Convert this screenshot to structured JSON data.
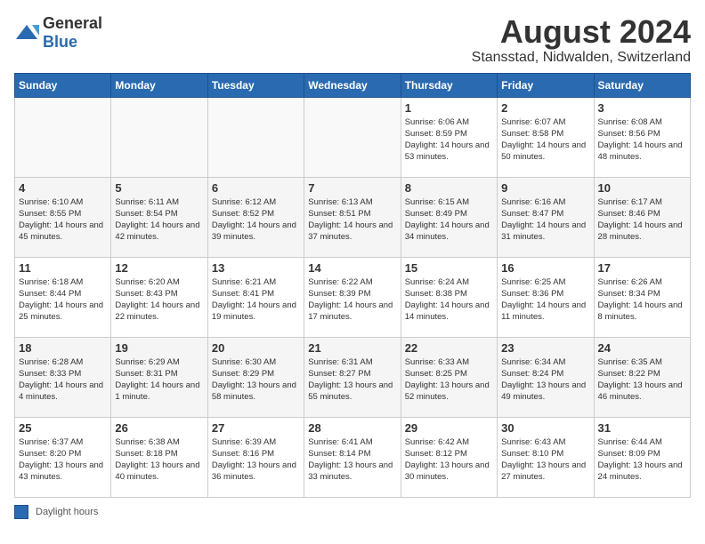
{
  "logo": {
    "general": "General",
    "blue": "Blue"
  },
  "title": "August 2024",
  "subtitle": "Stansstad, Nidwalden, Switzerland",
  "weekdays": [
    "Sunday",
    "Monday",
    "Tuesday",
    "Wednesday",
    "Thursday",
    "Friday",
    "Saturday"
  ],
  "weeks": [
    [
      {
        "day": "",
        "info": ""
      },
      {
        "day": "",
        "info": ""
      },
      {
        "day": "",
        "info": ""
      },
      {
        "day": "",
        "info": ""
      },
      {
        "day": "1",
        "info": "Sunrise: 6:06 AM\nSunset: 8:59 PM\nDaylight: 14 hours and 53 minutes."
      },
      {
        "day": "2",
        "info": "Sunrise: 6:07 AM\nSunset: 8:58 PM\nDaylight: 14 hours and 50 minutes."
      },
      {
        "day": "3",
        "info": "Sunrise: 6:08 AM\nSunset: 8:56 PM\nDaylight: 14 hours and 48 minutes."
      }
    ],
    [
      {
        "day": "4",
        "info": "Sunrise: 6:10 AM\nSunset: 8:55 PM\nDaylight: 14 hours and 45 minutes."
      },
      {
        "day": "5",
        "info": "Sunrise: 6:11 AM\nSunset: 8:54 PM\nDaylight: 14 hours and 42 minutes."
      },
      {
        "day": "6",
        "info": "Sunrise: 6:12 AM\nSunset: 8:52 PM\nDaylight: 14 hours and 39 minutes."
      },
      {
        "day": "7",
        "info": "Sunrise: 6:13 AM\nSunset: 8:51 PM\nDaylight: 14 hours and 37 minutes."
      },
      {
        "day": "8",
        "info": "Sunrise: 6:15 AM\nSunset: 8:49 PM\nDaylight: 14 hours and 34 minutes."
      },
      {
        "day": "9",
        "info": "Sunrise: 6:16 AM\nSunset: 8:47 PM\nDaylight: 14 hours and 31 minutes."
      },
      {
        "day": "10",
        "info": "Sunrise: 6:17 AM\nSunset: 8:46 PM\nDaylight: 14 hours and 28 minutes."
      }
    ],
    [
      {
        "day": "11",
        "info": "Sunrise: 6:18 AM\nSunset: 8:44 PM\nDaylight: 14 hours and 25 minutes."
      },
      {
        "day": "12",
        "info": "Sunrise: 6:20 AM\nSunset: 8:43 PM\nDaylight: 14 hours and 22 minutes."
      },
      {
        "day": "13",
        "info": "Sunrise: 6:21 AM\nSunset: 8:41 PM\nDaylight: 14 hours and 19 minutes."
      },
      {
        "day": "14",
        "info": "Sunrise: 6:22 AM\nSunset: 8:39 PM\nDaylight: 14 hours and 17 minutes."
      },
      {
        "day": "15",
        "info": "Sunrise: 6:24 AM\nSunset: 8:38 PM\nDaylight: 14 hours and 14 minutes."
      },
      {
        "day": "16",
        "info": "Sunrise: 6:25 AM\nSunset: 8:36 PM\nDaylight: 14 hours and 11 minutes."
      },
      {
        "day": "17",
        "info": "Sunrise: 6:26 AM\nSunset: 8:34 PM\nDaylight: 14 hours and 8 minutes."
      }
    ],
    [
      {
        "day": "18",
        "info": "Sunrise: 6:28 AM\nSunset: 8:33 PM\nDaylight: 14 hours and 4 minutes."
      },
      {
        "day": "19",
        "info": "Sunrise: 6:29 AM\nSunset: 8:31 PM\nDaylight: 14 hours and 1 minute."
      },
      {
        "day": "20",
        "info": "Sunrise: 6:30 AM\nSunset: 8:29 PM\nDaylight: 13 hours and 58 minutes."
      },
      {
        "day": "21",
        "info": "Sunrise: 6:31 AM\nSunset: 8:27 PM\nDaylight: 13 hours and 55 minutes."
      },
      {
        "day": "22",
        "info": "Sunrise: 6:33 AM\nSunset: 8:25 PM\nDaylight: 13 hours and 52 minutes."
      },
      {
        "day": "23",
        "info": "Sunrise: 6:34 AM\nSunset: 8:24 PM\nDaylight: 13 hours and 49 minutes."
      },
      {
        "day": "24",
        "info": "Sunrise: 6:35 AM\nSunset: 8:22 PM\nDaylight: 13 hours and 46 minutes."
      }
    ],
    [
      {
        "day": "25",
        "info": "Sunrise: 6:37 AM\nSunset: 8:20 PM\nDaylight: 13 hours and 43 minutes."
      },
      {
        "day": "26",
        "info": "Sunrise: 6:38 AM\nSunset: 8:18 PM\nDaylight: 13 hours and 40 minutes."
      },
      {
        "day": "27",
        "info": "Sunrise: 6:39 AM\nSunset: 8:16 PM\nDaylight: 13 hours and 36 minutes."
      },
      {
        "day": "28",
        "info": "Sunrise: 6:41 AM\nSunset: 8:14 PM\nDaylight: 13 hours and 33 minutes."
      },
      {
        "day": "29",
        "info": "Sunrise: 6:42 AM\nSunset: 8:12 PM\nDaylight: 13 hours and 30 minutes."
      },
      {
        "day": "30",
        "info": "Sunrise: 6:43 AM\nSunset: 8:10 PM\nDaylight: 13 hours and 27 minutes."
      },
      {
        "day": "31",
        "info": "Sunrise: 6:44 AM\nSunset: 8:09 PM\nDaylight: 13 hours and 24 minutes."
      }
    ]
  ],
  "footer": {
    "legend_label": "Daylight hours"
  }
}
